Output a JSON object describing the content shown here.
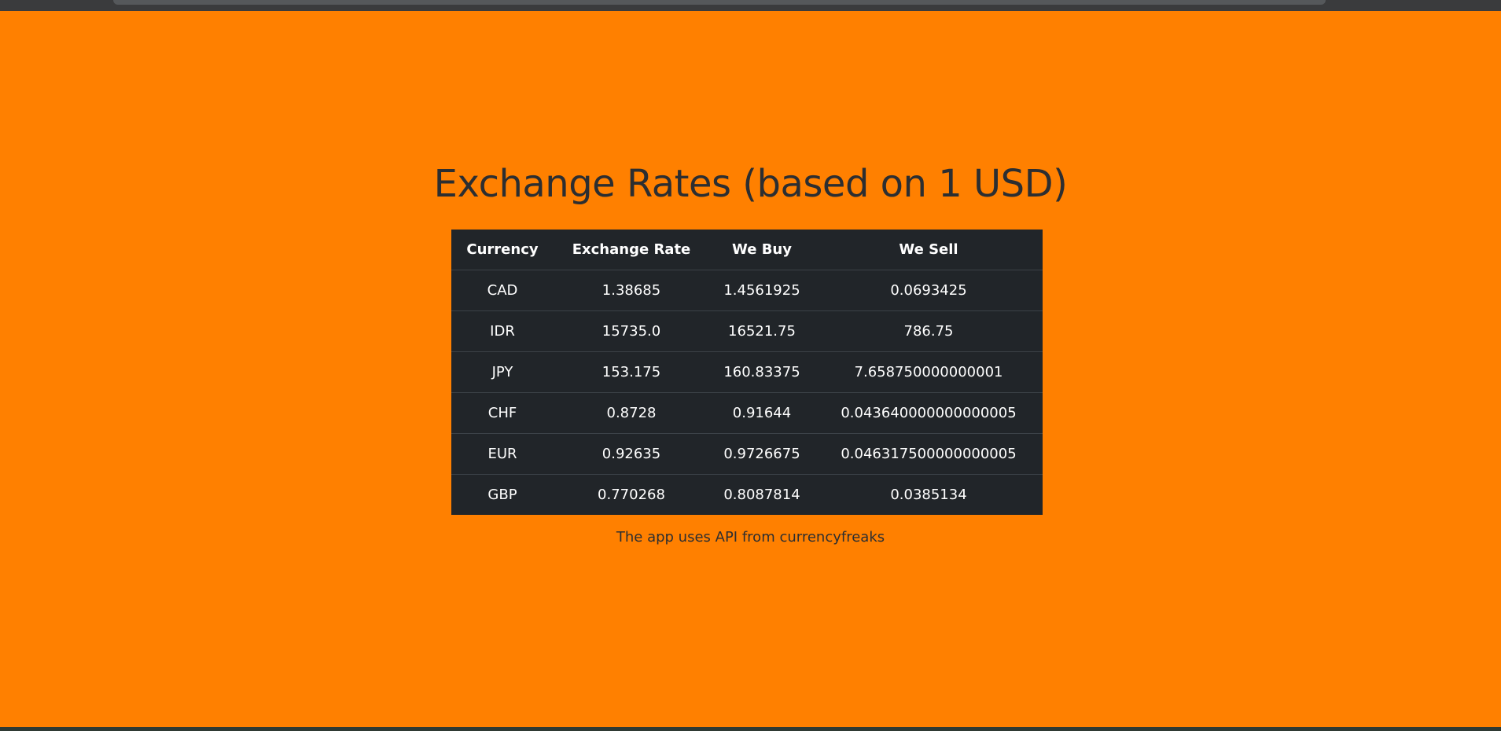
{
  "page": {
    "title": "Exchange Rates (based on 1 USD)",
    "footer": "The app uses API from currencyfreaks"
  },
  "table": {
    "headers": [
      "Currency",
      "Exchange Rate",
      "We Buy",
      "We Sell"
    ],
    "rows": [
      [
        "CAD",
        "1.38685",
        "1.4561925",
        "0.0693425"
      ],
      [
        "IDR",
        "15735.0",
        "16521.75",
        "786.75"
      ],
      [
        "JPY",
        "153.175",
        "160.83375",
        "7.658750000000001"
      ],
      [
        "CHF",
        "0.8728",
        "0.91644",
        "0.043640000000000005"
      ],
      [
        "EUR",
        "0.92635",
        "0.9726675",
        "0.046317500000000005"
      ],
      [
        "GBP",
        "0.770268",
        "0.8087814",
        "0.0385134"
      ]
    ]
  },
  "colors": {
    "background": "#ff8000",
    "table_background": "#212529",
    "title_text": "#2c2e31",
    "table_text": "#ffffff"
  }
}
